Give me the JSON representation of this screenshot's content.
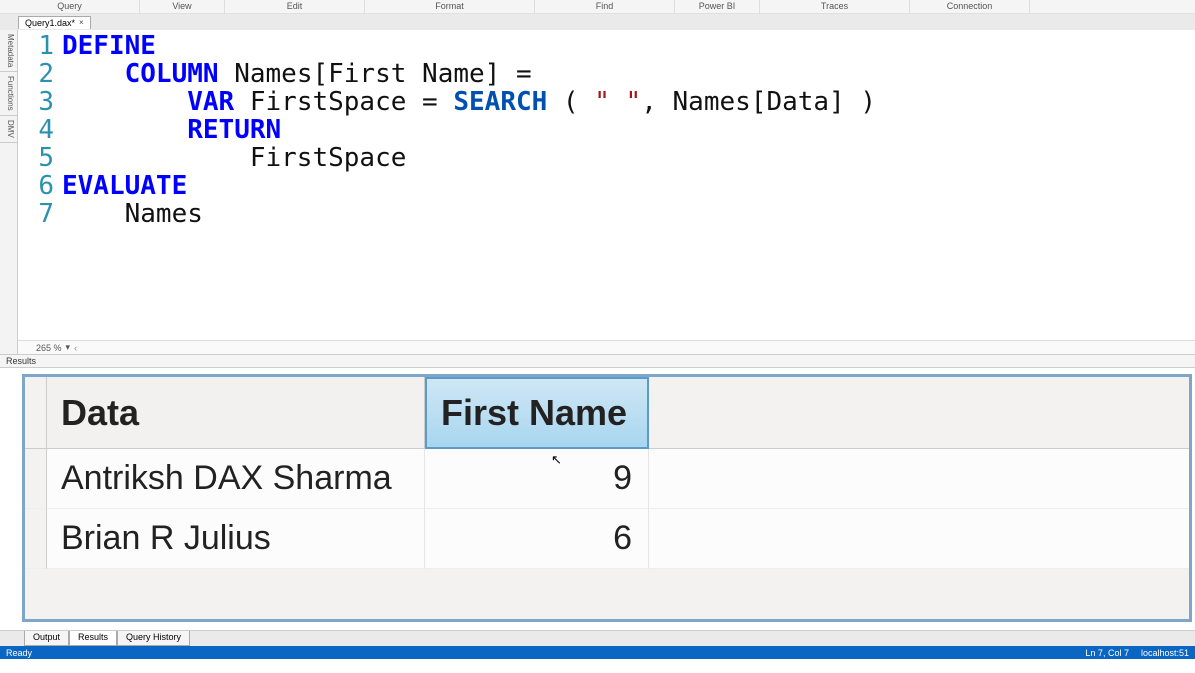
{
  "menu": {
    "items": [
      "Query",
      "View",
      "Edit",
      "Format",
      "Find",
      "Power BI",
      "Traces",
      "Connection"
    ],
    "widths": [
      140,
      85,
      140,
      170,
      140,
      85,
      150,
      120
    ]
  },
  "tab": {
    "name": "Query1.dax*",
    "close": "×"
  },
  "sidebar": {
    "items": [
      "Metadata",
      "Functions",
      "DMV"
    ]
  },
  "editor": {
    "line_numbers": [
      "1",
      "2",
      "3",
      "4",
      "5",
      "6",
      "7"
    ],
    "tokens": [
      [
        {
          "t": "DEFINE",
          "c": "kw-blue"
        }
      ],
      [
        {
          "t": "    ",
          "c": "kw-plain"
        },
        {
          "t": "COLUMN",
          "c": "kw-blue"
        },
        {
          "t": " Names[First Name] =",
          "c": "kw-plain"
        }
      ],
      [
        {
          "t": "        ",
          "c": "kw-plain"
        },
        {
          "t": "VAR",
          "c": "kw-blue"
        },
        {
          "t": " FirstSpace = ",
          "c": "kw-plain"
        },
        {
          "t": "SEARCH",
          "c": "kw-func"
        },
        {
          "t": " ( ",
          "c": "kw-plain"
        },
        {
          "t": "\" \"",
          "c": "kw-str"
        },
        {
          "t": ", Names[Data] )",
          "c": "kw-plain"
        }
      ],
      [
        {
          "t": "        ",
          "c": "kw-plain"
        },
        {
          "t": "RETURN",
          "c": "kw-blue"
        }
      ],
      [
        {
          "t": "            FirstSpace",
          "c": "kw-plain"
        }
      ],
      [
        {
          "t": "EVALUATE",
          "c": "kw-blue"
        }
      ],
      [
        {
          "t": "    Names",
          "c": "kw-plain"
        }
      ]
    ]
  },
  "zoom": {
    "value": "265 %",
    "arrow": "▾"
  },
  "results": {
    "label": "Results",
    "columns": [
      "Data",
      "First Name"
    ],
    "rows": [
      {
        "data": "Antriksh DAX Sharma",
        "first": "9"
      },
      {
        "data": "Brian R Julius",
        "first": "6"
      }
    ]
  },
  "bottom_tabs": {
    "items": [
      "Output",
      "Results",
      "Query History"
    ],
    "active": 1
  },
  "status": {
    "left": "Ready",
    "line": "Ln 7, Col 7",
    "conn": "localhost:51"
  }
}
